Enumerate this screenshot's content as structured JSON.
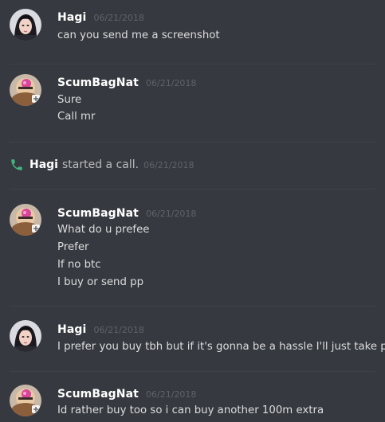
{
  "messages": [
    {
      "author": "Hagi",
      "timestamp": "06/21/2018",
      "avatar": "hagi-avatar",
      "lines": [
        "can you send me a screenshot"
      ]
    },
    {
      "author": "ScumBagNat",
      "timestamp": "06/21/2018",
      "avatar": "scumbagnat-avatar",
      "lines": [
        "Sure",
        "Call mr"
      ]
    },
    {
      "author": "ScumBagNat",
      "timestamp": "06/21/2018",
      "avatar": "scumbagnat-avatar",
      "lines": [
        "What do u prefee",
        "Prefer",
        "If no btc",
        "I buy or send pp"
      ]
    },
    {
      "author": "Hagi",
      "timestamp": "06/21/2018",
      "avatar": "hagi-avatar",
      "lines": [
        "I prefer you buy tbh but if it's gonna be a hassle I'll just take pp"
      ]
    },
    {
      "author": "ScumBagNat",
      "timestamp": "06/21/2018",
      "avatar": "scumbagnat-avatar",
      "lines": [
        "Id rather buy too so i can buy another 100m extra"
      ]
    }
  ],
  "system_message": {
    "icon": "phone-icon",
    "author": "Hagi",
    "text": "started a call.",
    "timestamp": "06/21/2018"
  },
  "colors": {
    "background": "#36393f",
    "author": "#ffffff",
    "message_text": "#dcddde",
    "timestamp": "#5f636a",
    "call_icon": "#43b581"
  }
}
